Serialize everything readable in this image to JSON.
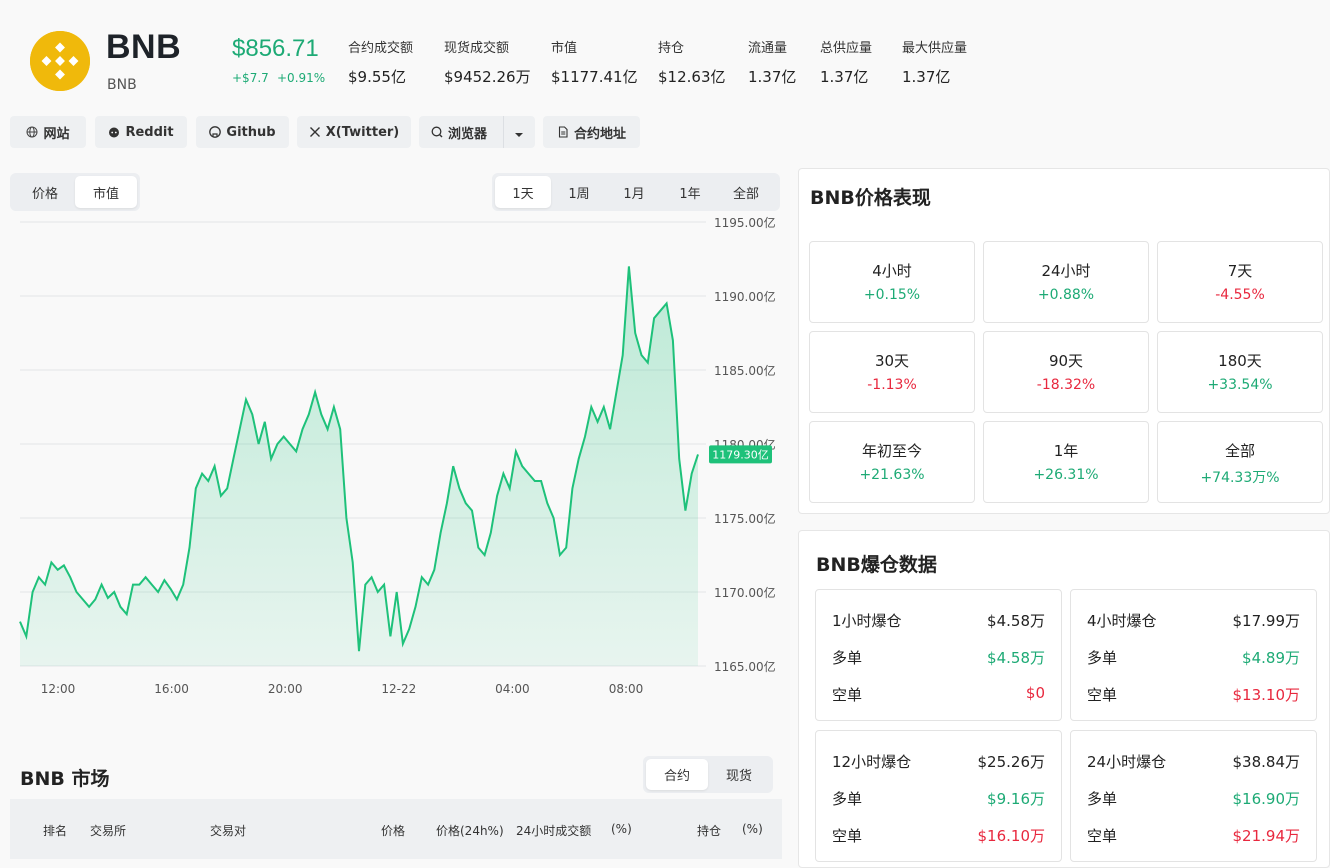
{
  "coin": {
    "name": "BNB",
    "symbol": "BNB",
    "price": "$856.71",
    "change_abs": "+$7.7",
    "change_pct": "+0.91%"
  },
  "stats": [
    {
      "label": "合约成交额",
      "value": "$9.55亿"
    },
    {
      "label": "现货成交额",
      "value": "$9452.26万"
    },
    {
      "label": "市值",
      "value": "$1177.41亿"
    },
    {
      "label": "持仓",
      "value": "$12.63亿"
    },
    {
      "label": "流通量",
      "value": "1.37亿"
    },
    {
      "label": "总供应量",
      "value": "1.37亿"
    },
    {
      "label": "最大供应量",
      "value": "1.37亿"
    }
  ],
  "links": {
    "website": "网站",
    "reddit": "Reddit",
    "github": "Github",
    "twitter": "X(Twitter)",
    "explorer": "浏览器",
    "contract": "合约地址"
  },
  "chart_tabs": {
    "price": "价格",
    "market_cap": "市值",
    "active": "市值"
  },
  "range_tabs": [
    "1天",
    "1周",
    "1月",
    "1年",
    "全部"
  ],
  "range_active": "1天",
  "chart_data": {
    "type": "area",
    "color": "#1ec17a",
    "x_ticks": [
      "12:00",
      "16:00",
      "20:00",
      "12-22",
      "04:00",
      "08:00"
    ],
    "y_ticks": [
      "1195.00亿",
      "1190.00亿",
      "1185.00亿",
      "1180.00亿",
      "1175.00亿",
      "1170.00亿",
      "1165.00亿"
    ],
    "ylim": [
      1165,
      1195
    ],
    "current_label": "1179.30亿",
    "current_value": 1179.3,
    "y": [
      1168,
      1167,
      1170,
      1171,
      1170.5,
      1172,
      1171.5,
      1171.8,
      1171,
      1170,
      1169.5,
      1169,
      1169.5,
      1170.5,
      1169.6,
      1170,
      1169,
      1168.5,
      1170.5,
      1170.5,
      1171,
      1170.5,
      1170,
      1170.8,
      1170.2,
      1169.5,
      1170.5,
      1173,
      1177,
      1178,
      1177.5,
      1178.5,
      1176.5,
      1177,
      1179,
      1181,
      1183,
      1182,
      1180,
      1181.5,
      1179,
      1180,
      1180.5,
      1180,
      1179.5,
      1181,
      1182,
      1183.5,
      1182,
      1181,
      1182.5,
      1181,
      1175,
      1172,
      1166,
      1170.5,
      1171,
      1170,
      1170.5,
      1167,
      1170,
      1166.5,
      1167.5,
      1169,
      1171,
      1170.5,
      1171.5,
      1174,
      1176,
      1178.5,
      1177,
      1176,
      1175.5,
      1173,
      1172.5,
      1174,
      1176.5,
      1178,
      1177,
      1179.5,
      1178.5,
      1178,
      1177.5,
      1177.5,
      1176,
      1175,
      1172.5,
      1173,
      1177,
      1179,
      1180.5,
      1182.5,
      1181.5,
      1182.5,
      1181,
      1183.5,
      1186,
      1192,
      1187.5,
      1186,
      1185.5,
      1188.5,
      1189,
      1189.5,
      1187,
      1179,
      1175.5,
      1178,
      1179.3
    ]
  },
  "market": {
    "title": "BNB 市场",
    "tabs": [
      "合约",
      "现货"
    ],
    "tab_active": "合约",
    "columns": [
      "排名",
      "交易所",
      "交易对",
      "价格",
      "价格(24h%)",
      "24小时成交额",
      "(%)",
      "持仓",
      "(%)"
    ]
  },
  "performance": {
    "title": "BNB价格表现",
    "cells": [
      {
        "label": "4小时",
        "value": "+0.15%",
        "dir": "up"
      },
      {
        "label": "24小时",
        "value": "+0.88%",
        "dir": "up"
      },
      {
        "label": "7天",
        "value": "-4.55%",
        "dir": "down"
      },
      {
        "label": "30天",
        "value": "-1.13%",
        "dir": "down"
      },
      {
        "label": "90天",
        "value": "-18.32%",
        "dir": "down"
      },
      {
        "label": "180天",
        "value": "+33.54%",
        "dir": "up"
      },
      {
        "label": "年初至今",
        "value": "+21.63%",
        "dir": "up"
      },
      {
        "label": "1年",
        "value": "+26.31%",
        "dir": "up"
      },
      {
        "label": "全部",
        "value": "+74.33万%",
        "dir": "up"
      }
    ]
  },
  "liquidations": {
    "title": "BNB爆仓数据",
    "long_label": "多单",
    "short_label": "空单",
    "cells": [
      {
        "label": "1小时爆仓",
        "total": "$4.58万",
        "long": "$4.58万",
        "short": "$0"
      },
      {
        "label": "4小时爆仓",
        "total": "$17.99万",
        "long": "$4.89万",
        "short": "$13.10万"
      },
      {
        "label": "12小时爆仓",
        "total": "$25.26万",
        "long": "$9.16万",
        "short": "$16.10万"
      },
      {
        "label": "24小时爆仓",
        "total": "$38.84万",
        "long": "$16.90万",
        "short": "$21.94万"
      }
    ]
  }
}
